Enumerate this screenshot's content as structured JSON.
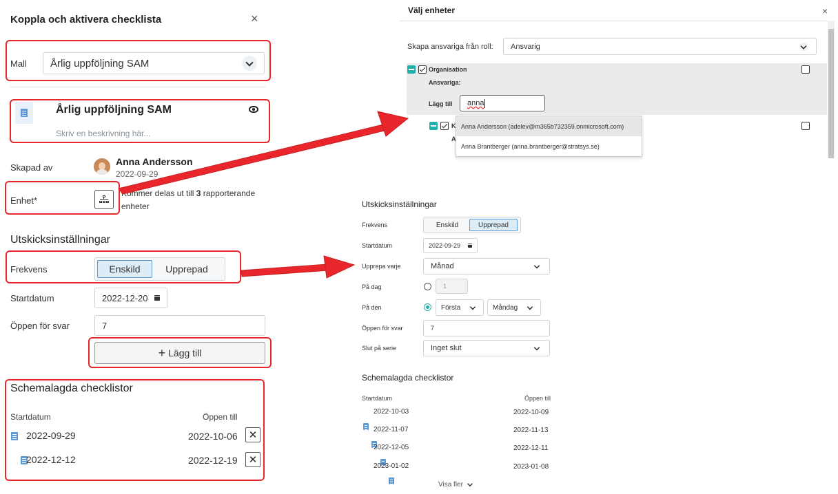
{
  "left_panel": {
    "title": "Koppla och aktivera checklista",
    "close_glyph": "×",
    "template_label": "Mall",
    "template_value": "Årlig uppföljning SAM",
    "card_title": "Årlig uppföljning SAM",
    "card_description_placeholder": "Skriv en beskrivning här...",
    "created_by_label": "Skapad av",
    "creator_name": "Anna Andersson",
    "created_date": "2022-09-29",
    "unit_label": "Enhet*",
    "unit_text_prefix": "Kommer delas ut till ",
    "unit_count": "3",
    "unit_text_suffix": " rapporterande",
    "unit_text_line2": "enheter",
    "dispatch_heading": "Utskicksinställningar",
    "frequency_label": "Frekvens",
    "freq_single": "Enskild",
    "freq_repeat": "Upprepad",
    "start_label": "Startdatum",
    "start_value": "2022-12-20",
    "open_label": "Öppen för svar",
    "open_value": "7",
    "add_button": "Lägg till",
    "add_plus": "+",
    "scheduled_heading": "Schemalagda checklistor",
    "col_start": "Startdatum",
    "col_open": "Öppen till",
    "rows": [
      {
        "start": "2022-09-29",
        "end": "2022-10-06"
      },
      {
        "start": "2022-12-12",
        "end": "2022-12-19"
      }
    ],
    "row_delete_glyph": "✕"
  },
  "units_dialog": {
    "title": "Välj enheter",
    "close_glyph": "×",
    "role_label": "Skapa ansvariga från roll:",
    "role_value": "Ansvarig",
    "org_name": "Organisation",
    "responsible_label": "Ansvariga:",
    "add_label": "Lägg till",
    "add_input_value": "anna",
    "child_initial": "K",
    "child_sub_initial": "A",
    "suggestions": [
      "Anna Andersson (adelev@m365b732359.onmicrosoft.com)",
      "Anna Brantberger (anna.brantberger@stratsys.se)"
    ]
  },
  "right_settings": {
    "heading": "Utskicksinställningar",
    "frequency_label": "Frekvens",
    "freq_single": "Enskild",
    "freq_repeat": "Upprepad",
    "start_label": "Startdatum",
    "start_value": "2022-09-29",
    "repeat_label": "Upprepa varje",
    "repeat_value": "Månad",
    "on_day_label": "På dag",
    "on_day_value": "1",
    "on_the_label": "På den",
    "on_the_ordinal": "Första",
    "on_the_weekday": "Måndag",
    "open_label": "Öppen för svar",
    "open_value": "7",
    "end_label": "Slut på serie",
    "end_value": "Inget slut",
    "scheduled_heading": "Schemalagda checklistor",
    "col_start": "Startdatum",
    "col_open": "Öppen till",
    "rows": [
      {
        "start": "2022-10-03",
        "end": "2022-10-09"
      },
      {
        "start": "2022-11-07",
        "end": "2022-11-13"
      },
      {
        "start": "2022-12-05",
        "end": "2022-12-11"
      },
      {
        "start": "2023-01-02",
        "end": "2023-01-08"
      }
    ],
    "show_more": "Visa fler"
  },
  "colors": {
    "highlight_red": "#e8262b",
    "accent_teal": "#20b2aa",
    "accent_blue": "#5b9ad6",
    "active_segment": "#dcedf7"
  }
}
